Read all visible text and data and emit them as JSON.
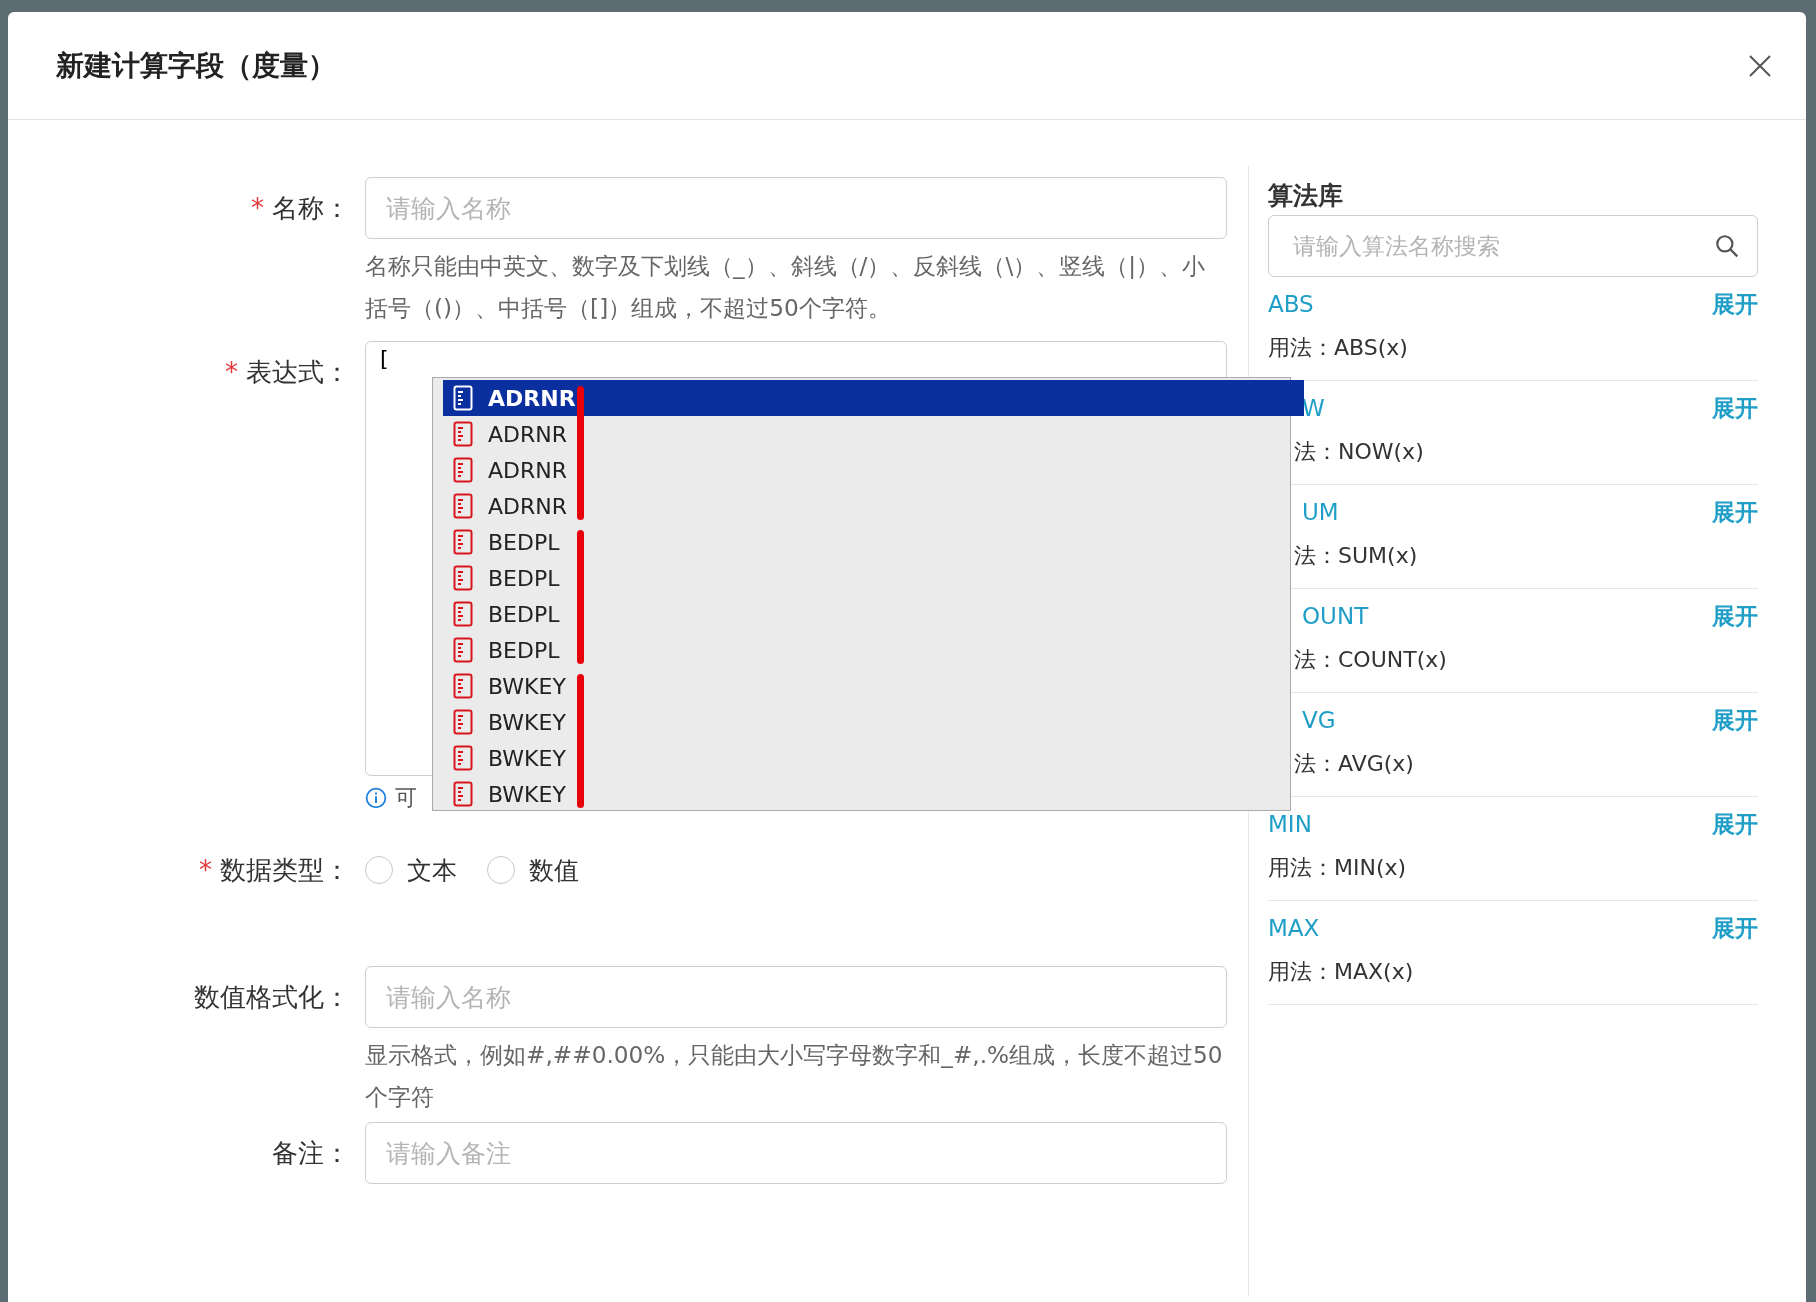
{
  "dialog": {
    "title": "新建计算字段（度量）"
  },
  "form": {
    "name": {
      "label": "名称：",
      "required_mark": "*",
      "placeholder": "请输入名称",
      "help": "名称只能由中英文、数字及下划线（_）、斜线（/）、反斜线（\\）、竖线（|）、小括号（()）、中括号（[]）组成，不超过50个字符。"
    },
    "expression": {
      "label": "表达式：",
      "required_mark": "*",
      "value": "[",
      "hint": "可"
    },
    "autocomplete": {
      "groups": [
        {
          "highlighted": true,
          "items": [
            {
              "label": "ADRNR",
              "selected": true
            },
            {
              "label": "ADRNR",
              "selected": false
            },
            {
              "label": "ADRNR",
              "selected": false
            },
            {
              "label": "ADRNR",
              "selected": false
            }
          ]
        },
        {
          "highlighted": true,
          "items": [
            {
              "label": "BEDPL",
              "selected": false
            },
            {
              "label": "BEDPL",
              "selected": false
            },
            {
              "label": "BEDPL",
              "selected": false
            },
            {
              "label": "BEDPL",
              "selected": false
            }
          ]
        },
        {
          "highlighted": true,
          "items": [
            {
              "label": "BWKEY",
              "selected": false
            },
            {
              "label": "BWKEY",
              "selected": false
            },
            {
              "label": "BWKEY",
              "selected": false
            },
            {
              "label": "BWKEY",
              "selected": false
            }
          ]
        }
      ]
    },
    "data_type": {
      "label": "数据类型：",
      "required_mark": "*",
      "options": [
        {
          "label": "文本",
          "selected": false
        },
        {
          "label": "数值",
          "selected": false
        }
      ]
    },
    "number_format": {
      "label": "数值格式化：",
      "placeholder": "请输入名称",
      "help": "显示格式，例如#,##0.00%，只能由大小写字母数字和_#,.%组成，长度不超过50个字符"
    },
    "remark": {
      "label": "备注：",
      "placeholder": "请输入备注"
    }
  },
  "library": {
    "title": "算法库",
    "search_placeholder": "请输入算法名称搜索",
    "items": [
      {
        "name": "ABS",
        "usage": "用法：ABS(x)",
        "action": "展开",
        "clipped": false
      },
      {
        "name": "W",
        "usage": "法：NOW(x)",
        "action": "展开",
        "clipped": true
      },
      {
        "name": "UM",
        "usage": "法：SUM(x)",
        "action": "展开",
        "clipped": true
      },
      {
        "name": "OUNT",
        "usage": "法：COUNT(x)",
        "action": "展开",
        "clipped": true
      },
      {
        "name": "VG",
        "usage": "法：AVG(x)",
        "action": "展开",
        "clipped": true
      },
      {
        "name": "MIN",
        "usage": "用法：MIN(x)",
        "action": "展开",
        "clipped": false
      },
      {
        "name": "MAX",
        "usage": "用法：MAX(x)",
        "action": "展开",
        "clipped": false
      }
    ]
  }
}
